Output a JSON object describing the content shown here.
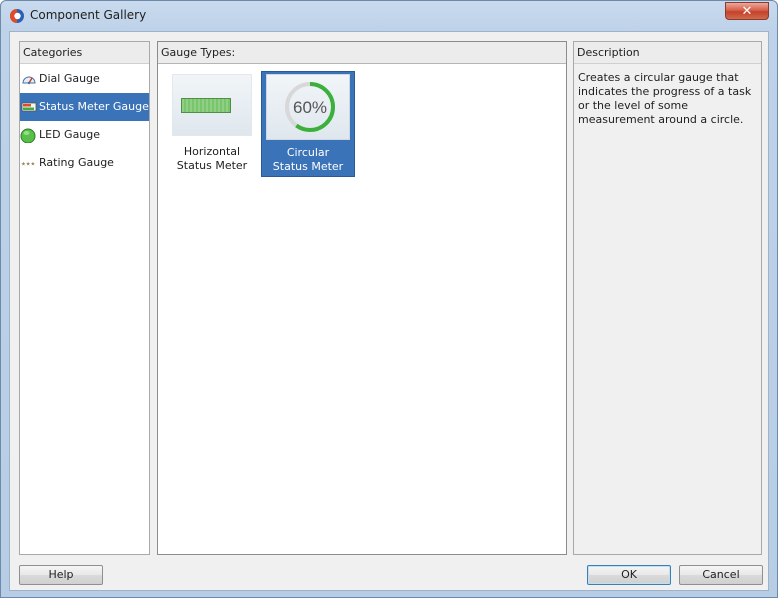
{
  "window": {
    "title": "Component Gallery",
    "close_label": "✕"
  },
  "categories": {
    "header": "Categories",
    "items": [
      {
        "label": "Dial Gauge",
        "icon": "dial-gauge-icon",
        "selected": false
      },
      {
        "label": "Status Meter Gauge",
        "icon": "status-meter-icon",
        "selected": true
      },
      {
        "label": "LED Gauge",
        "icon": "led-gauge-icon",
        "selected": false
      },
      {
        "label": "Rating Gauge",
        "icon": "rating-gauge-icon",
        "selected": false
      }
    ]
  },
  "gauge_types": {
    "header": "Gauge Types:",
    "tiles": [
      {
        "line1": "Horizontal",
        "line2": "Status Meter",
        "selected": false
      },
      {
        "line1": "Circular",
        "line2": "Status Meter",
        "selected": true,
        "value_text": "60%",
        "progress": 0.6
      }
    ]
  },
  "description": {
    "header": "Description",
    "text": "Creates a circular gauge that indicates the progress of a task or the level of some measurement around a circle."
  },
  "buttons": {
    "help": "Help",
    "ok": "OK",
    "cancel": "Cancel"
  },
  "colors": {
    "selection": "#3b73b9",
    "gauge_green": "#3bb03b",
    "bar_green": "#79c56b"
  }
}
